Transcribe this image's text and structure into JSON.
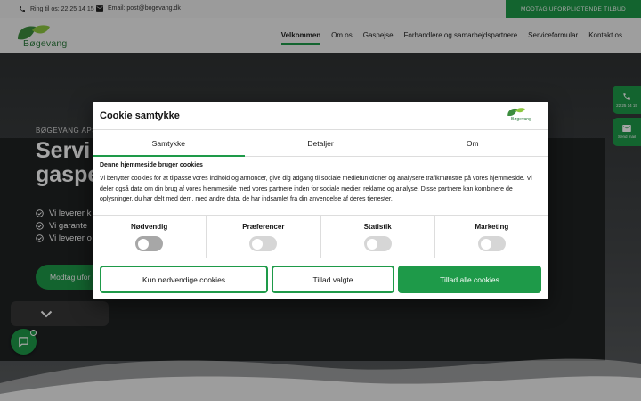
{
  "topbar": {
    "phone_label": "Ring til os: 22 25 14 15",
    "email_label": "Email: post@bogevang.dk",
    "cta_label": "MODTAG UFORPLIGTENDE TILBUD"
  },
  "nav": {
    "logo_text": "Bøgevang",
    "menu": [
      "Velkommen",
      "Om os",
      "Gaspejse",
      "Forhandlere og samarbejdspartnere",
      "Serviceformular",
      "Kontakt os"
    ]
  },
  "hero": {
    "eyebrow": "BØGEVANG APS",
    "title": "Servi gaspe",
    "bullets": [
      "Vi leverer k",
      "Vi garante",
      "Vi leverer o"
    ],
    "cta_label": "Modtag ufor"
  },
  "side": {
    "phone_text": "22 25 14 15",
    "mail_text": "Send mail"
  },
  "cookie": {
    "title": "Cookie samtykke",
    "logo_text": "Bøgevang",
    "tabs": [
      "Samtykke",
      "Detaljer",
      "Om"
    ],
    "heading": "Denne hjemmeside bruger cookies",
    "body": "Vi benytter cookies for at tilpasse vores indhold og annoncer, give dig adgang til sociale mediefunktioner og analysere trafikmønstre på vores hjemmeside. Vi deler også data om din brug af vores hjemmeside med vores partnere inden for sociale medier, reklame og analyse. Disse partnere kan kombinere de oplysninger, du har delt med dem, med andre data, de har indsamlet fra din anvendelse af deres tjenester.",
    "categories": [
      "Nødvendig",
      "Præferencer",
      "Statistik",
      "Marketing"
    ],
    "buttons": {
      "necessary": "Kun nødvendige cookies",
      "selected": "Tillad valgte",
      "all": "Tillad alle cookies"
    }
  },
  "colors": {
    "brand_green": "#1e9a49"
  }
}
